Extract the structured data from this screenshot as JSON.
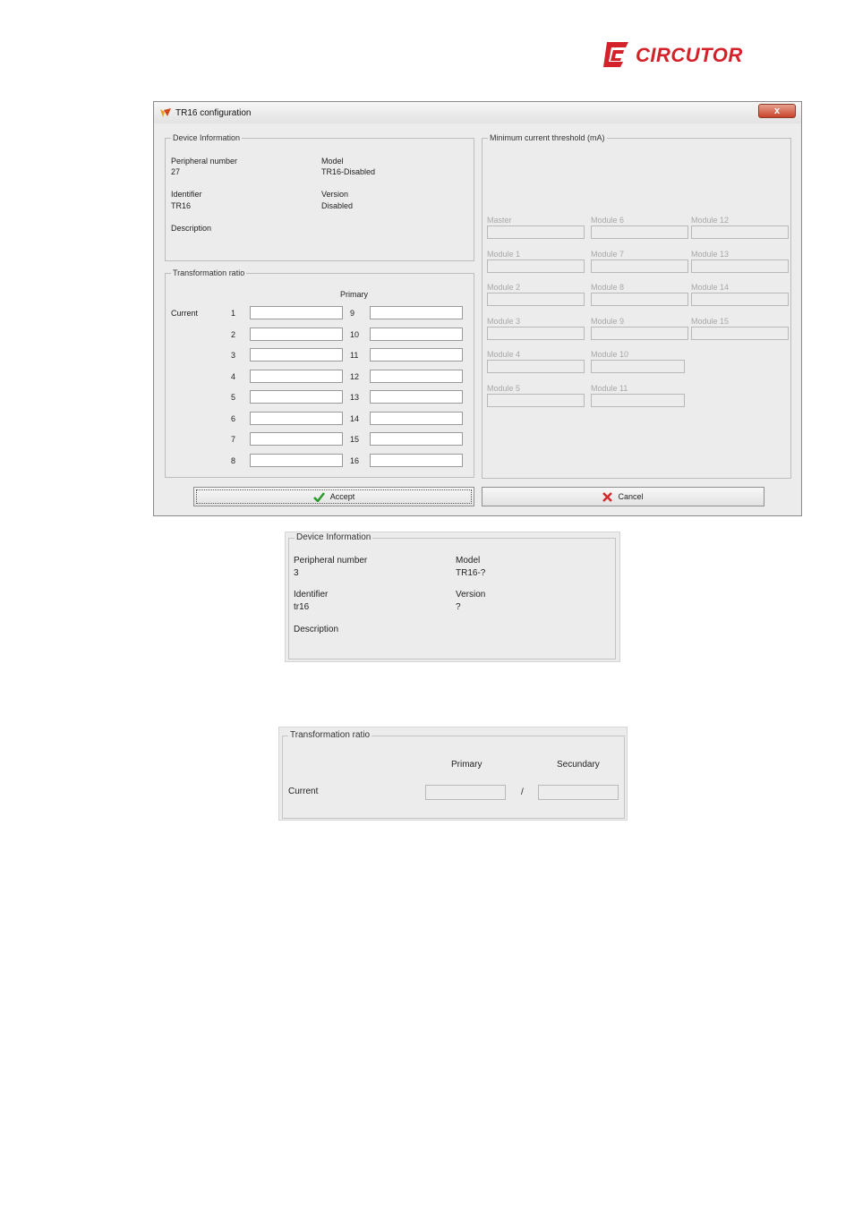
{
  "brand": {
    "name": "CIRCUTOR",
    "color": "#d3222a"
  },
  "dialog": {
    "title": "TR16 configuration",
    "close_label": "x",
    "device_info": {
      "legend": "Device Information",
      "peripheral_label": "Peripheral number",
      "peripheral_value": "27",
      "model_label": "Model",
      "model_value": "TR16-Disabled",
      "identifier_label": "Identifier",
      "identifier_value": "TR16",
      "version_label": "Version",
      "version_value": "Disabled",
      "description_label": "Description"
    },
    "transformation": {
      "legend": "Transformation ratio",
      "primary_label": "Primary",
      "current_label": "Current",
      "rows_left": [
        "1",
        "2",
        "3",
        "4",
        "5",
        "6",
        "7",
        "8"
      ],
      "rows_right": [
        "9",
        "10",
        "11",
        "12",
        "13",
        "14",
        "15",
        "16"
      ]
    },
    "threshold": {
      "legend": "Minimum current threshold (mA)",
      "col1": [
        "Master",
        "Module 1",
        "Module 2",
        "Module 3",
        "Module 4",
        "Module 5"
      ],
      "col2": [
        "Module 6",
        "Module 7",
        "Module 8",
        "Module 9",
        "Module 10",
        "Module 11"
      ],
      "col3": [
        "Module 12",
        "Module 13",
        "Module 14",
        "Module 15"
      ]
    },
    "accept_label": "Accept",
    "cancel_label": "Cancel"
  },
  "panel_device": {
    "legend": "Device Information",
    "peripheral_label": "Peripheral number",
    "peripheral_value": "3",
    "model_label": "Model",
    "model_value": "TR16-?",
    "identifier_label": "Identifier",
    "identifier_value": "tr16",
    "version_label": "Version",
    "version_value": "?",
    "description_label": "Description"
  },
  "panel_ratio": {
    "legend": "Transformation ratio",
    "primary_label": "Primary",
    "secondary_label": "Secundary",
    "current_label": "Current",
    "separator": "/"
  }
}
